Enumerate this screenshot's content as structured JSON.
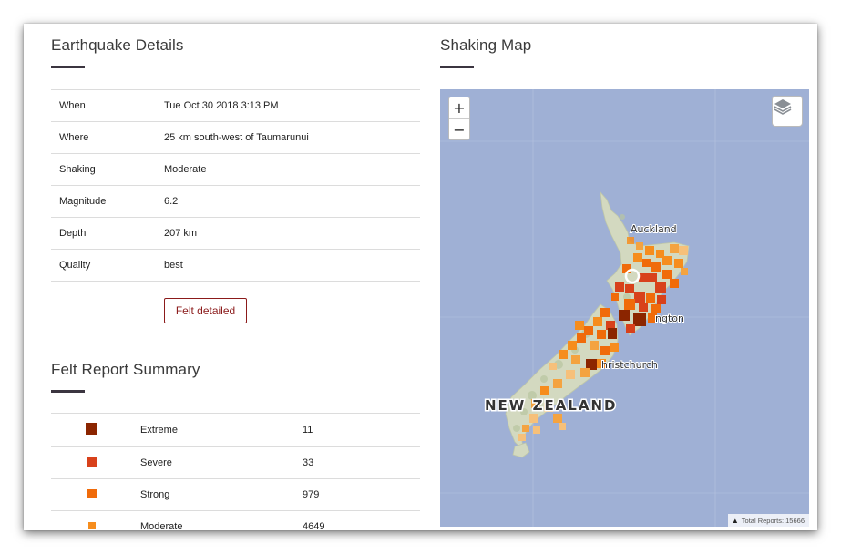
{
  "details": {
    "title": "Earthquake Details",
    "rows": [
      {
        "label": "When",
        "value": "Tue Oct 30 2018 3:13 PM"
      },
      {
        "label": "Where",
        "value": "25 km south-west of Taumarunui"
      },
      {
        "label": "Shaking",
        "value": "Moderate"
      },
      {
        "label": "Magnitude",
        "value": "6.2"
      },
      {
        "label": "Depth",
        "value": "207 km"
      },
      {
        "label": "Quality",
        "value": "best"
      }
    ],
    "felt_button": "Felt detailed"
  },
  "summary": {
    "title": "Felt Report Summary",
    "rows": [
      {
        "label": "Extreme",
        "count": "11",
        "color": "#8b2500"
      },
      {
        "label": "Severe",
        "count": "33",
        "color": "#d8411b"
      },
      {
        "label": "Strong",
        "count": "979",
        "color": "#f06b0a"
      },
      {
        "label": "Moderate",
        "count": "4649",
        "color": "#f68d1d"
      }
    ]
  },
  "map": {
    "title": "Shaking Map",
    "zoom_in": "+",
    "zoom_out": "−",
    "layers_icon": "layers-icon",
    "attribution": "Total Reports: 15666",
    "labels": {
      "auckland": "Auckland",
      "wellington": "ngton",
      "christchurch": "hristchurch",
      "country": "NEW ZEALAND"
    }
  }
}
